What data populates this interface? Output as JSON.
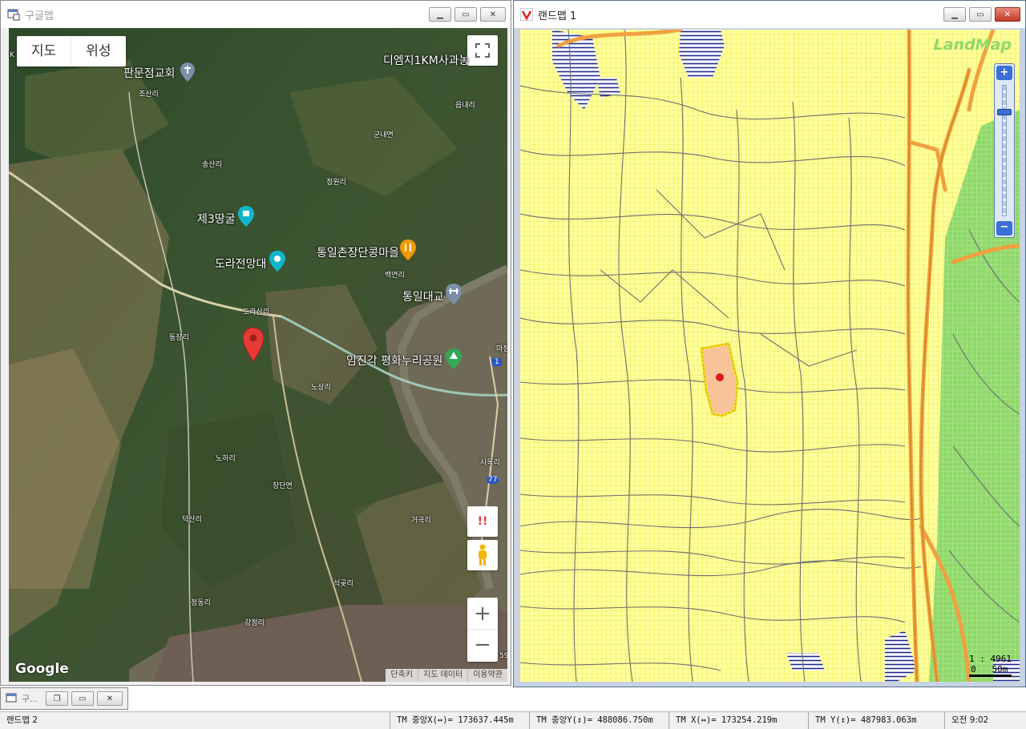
{
  "google_window": {
    "title": "구글맵",
    "map_type": {
      "map": "지도",
      "satellite": "위성"
    },
    "labels": [
      {
        "text": "판문점교회",
        "style": "big"
      },
      {
        "text": "조산리",
        "style": "small"
      },
      {
        "text": "디엠지1KM사과농",
        "style": "big"
      },
      {
        "text": "읍내리",
        "style": "small"
      },
      {
        "text": "군내면",
        "style": "small"
      },
      {
        "text": "송산리",
        "style": "small"
      },
      {
        "text": "점원리",
        "style": "small"
      },
      {
        "text": "제3땅굴",
        "style": "big"
      },
      {
        "text": "통일촌장단콩마을",
        "style": "big"
      },
      {
        "text": "도라전망대",
        "style": "big"
      },
      {
        "text": "백연리",
        "style": "small"
      },
      {
        "text": "통일대교",
        "style": "big"
      },
      {
        "text": "도라산리",
        "style": "small"
      },
      {
        "text": "동장리",
        "style": "small"
      },
      {
        "text": "임진각 평화누리공원",
        "style": "big"
      },
      {
        "text": "노상리",
        "style": "small"
      },
      {
        "text": "노하리",
        "style": "small"
      },
      {
        "text": "장단면",
        "style": "small"
      },
      {
        "text": "덕산리",
        "style": "small"
      },
      {
        "text": "거곡리",
        "style": "small"
      },
      {
        "text": "석곶리",
        "style": "small"
      },
      {
        "text": "정동리",
        "style": "small"
      },
      {
        "text": "강정리",
        "style": "small"
      },
      {
        "text": "사목리",
        "style": "small"
      },
      {
        "text": "마정",
        "style": "small"
      },
      {
        "text": "K",
        "style": "small"
      },
      {
        "text": "1",
        "style": "small"
      },
      {
        "text": "77",
        "style": "small"
      },
      {
        "text": "59",
        "style": "small"
      }
    ],
    "logo": "Google",
    "footer": [
      "단축키",
      "지도 데이터",
      "이용약관"
    ],
    "controls": {
      "zoom_in": "+",
      "zoom_out": "−",
      "alert": "!!"
    }
  },
  "landmap_window": {
    "title": "랜드맵 1",
    "logo": "LandMap",
    "scale_ratio": "1 : 4961",
    "scale_bar": "0   50m"
  },
  "mini_window": {
    "title": "구..."
  },
  "statusbar": {
    "window_name": "랜드맵 2",
    "tm_center_x": "TM 중앙X(↔)= 173637.445m",
    "tm_center_y": "TM 중앙Y(↕)= 488086.750m",
    "tm_x": "TM X(↔)= 173254.219m",
    "tm_y": "TM Y(↕)= 487983.063m",
    "time": "오전 9:02"
  },
  "colors": {
    "marker": "#e53935",
    "parcel_fill": "#f7c49a",
    "parcel_outline": "#f2e21c",
    "landmap_bg": "#ffff9c",
    "forest_green": "#8fd86b",
    "road_orange": "#f0a040",
    "water_blue": "#1c2a8c"
  }
}
